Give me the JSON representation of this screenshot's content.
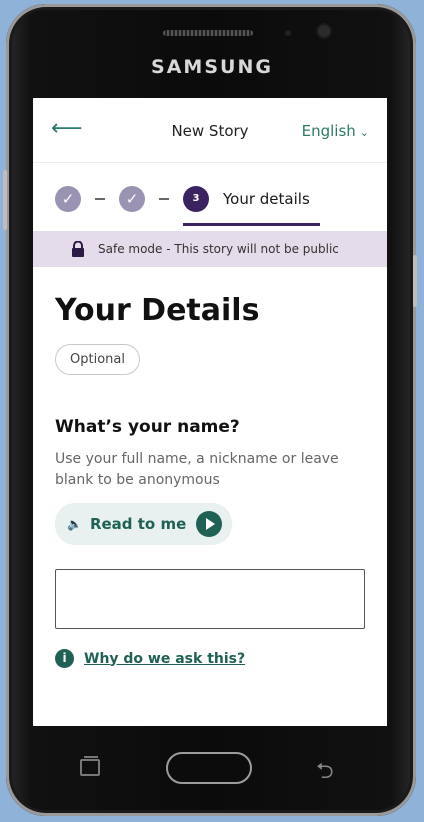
{
  "device": {
    "brand": "SAMSUNG"
  },
  "header": {
    "back_icon": "arrow-left-icon",
    "title": "New Story",
    "language": "English",
    "language_icon": "chevron-down-icon",
    "accent_color": "#2c7a6a"
  },
  "stepper": {
    "steps": [
      {
        "state": "done",
        "icon": "check-icon"
      },
      {
        "state": "done",
        "icon": "check-icon"
      },
      {
        "state": "current",
        "number": "3",
        "label": "Your details"
      }
    ],
    "done_color": "#9b93b3",
    "current_color": "#3a2360"
  },
  "safe_mode": {
    "icon": "lock-icon",
    "text": "Safe mode - This story will not be public"
  },
  "form": {
    "heading": "Your Details",
    "optional_badge": "Optional",
    "question": "What’s your name?",
    "hint": "Use your full name, a nickname or leave blank to be anonymous",
    "read_button": "Read to me",
    "read_icon": "speaker-icon",
    "play_icon": "play-icon",
    "name_value": "",
    "why_link": "Why do we ask this?",
    "why_icon": "info-icon"
  }
}
